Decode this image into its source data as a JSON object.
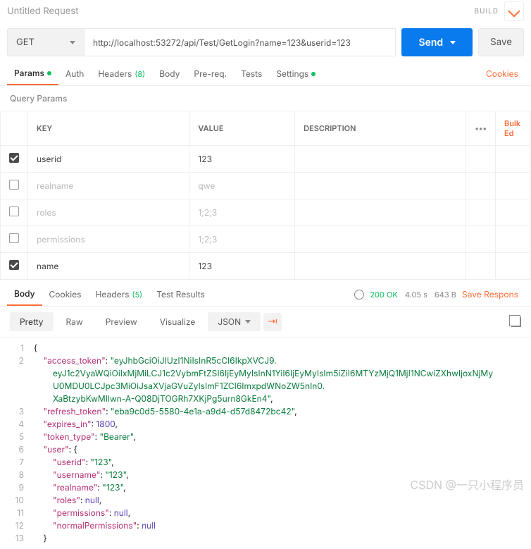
{
  "header": {
    "title": "Untitled Request",
    "build": "BUILD"
  },
  "request": {
    "method": "GET",
    "url": "http://localhost:53272/api/Test/GetLogin?name=123&userid=123",
    "send": "Send",
    "save": "Save"
  },
  "reqTabs": {
    "params": "Params",
    "auth": "Auth",
    "headers": "Headers",
    "headers_count": "(8)",
    "body": "Body",
    "prereq": "Pre-req.",
    "tests": "Tests",
    "settings": "Settings",
    "cookies": "Cookies"
  },
  "paramsSection": {
    "title": "Query Params",
    "cols": {
      "key": "KEY",
      "value": "VALUE",
      "desc": "DESCRIPTION"
    },
    "bulk": "Bulk Ed",
    "rows": [
      {
        "on": true,
        "key": "userid",
        "value": "123"
      },
      {
        "on": false,
        "key": "realname",
        "value": "qwe"
      },
      {
        "on": false,
        "key": "roles",
        "value": "1;2;3"
      },
      {
        "on": false,
        "key": "permissions",
        "value": "1;2;3"
      },
      {
        "on": true,
        "key": "name",
        "value": "123"
      }
    ]
  },
  "respTabs": {
    "body": "Body",
    "cookies": "Cookies",
    "headers": "Headers",
    "headers_count": "(5)",
    "tests": "Test Results",
    "status": "200 OK",
    "time": "4.05 s",
    "size": "643 B",
    "save": "Save Respons"
  },
  "viewBar": {
    "pretty": "Pretty",
    "raw": "Raw",
    "preview": "Preview",
    "visualize": "Visualize",
    "format": "JSON"
  },
  "responseBody": {
    "access_token": "eyJhbGciOiJIUzI1NiIsInR5cCI6IkpXVCJ9.eyJ1c2VyaWQiOiIxMjMiLCJ1c2VybmFtZSI6IjEyMyIsInN1YiI6IjEyMyIsIm5iZiI6MTYzMjQ1MjI1NCwiZXhwIjoxNjMyU0MDU0LCJpc3MiOiJsaXVjaGVuZyIsImF1ZCI6ImxpdWNoZW5nIn0.XaBtzybKwMIlwn-A-Q08DjTOGRh7XKjPg5urn8GkEn4",
    "refresh_token": "eba9c0d5-5580-4e1a-a9d4-d57d8472bc42",
    "expires_in": 1800,
    "token_type": "Bearer",
    "user": {
      "userid": "123",
      "username": "123",
      "realname": "123",
      "roles": null,
      "permissions": null,
      "normalPermissions": null
    }
  },
  "watermark": "CSDN @一只小程序员"
}
